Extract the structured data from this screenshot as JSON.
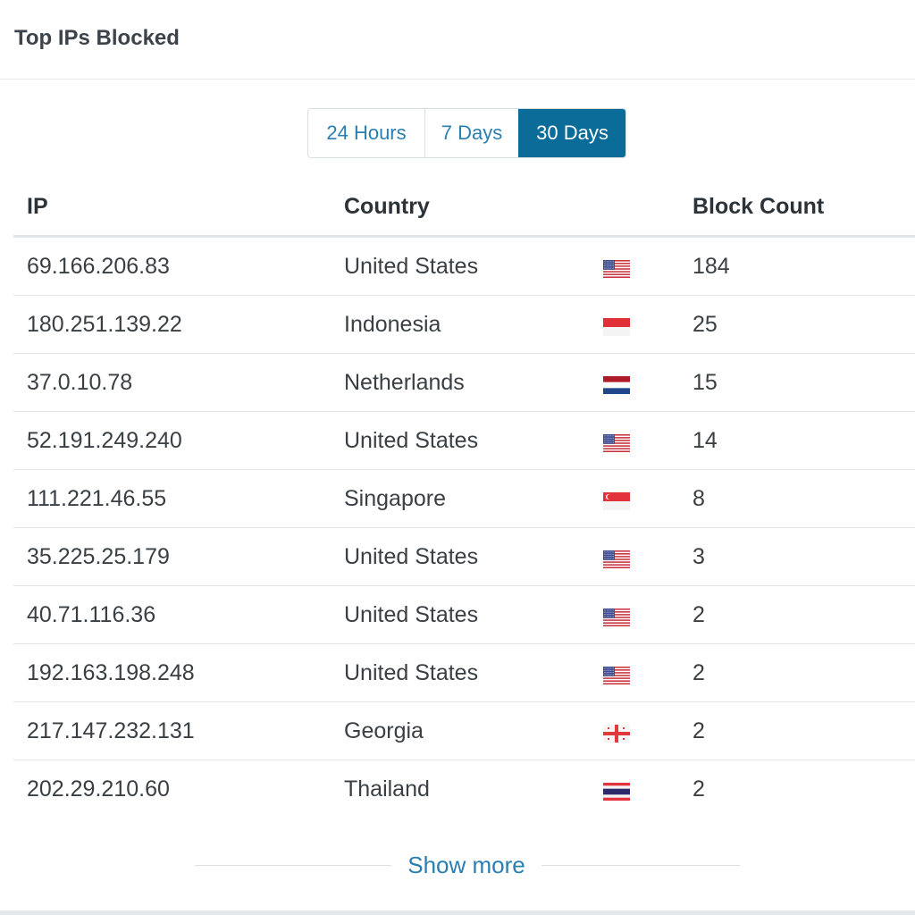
{
  "panel": {
    "title": "Top IPs Blocked"
  },
  "range_options": [
    {
      "label": "24 Hours",
      "active": false
    },
    {
      "label": "7 Days",
      "active": false
    },
    {
      "label": "30 Days",
      "active": true
    }
  ],
  "table": {
    "headers": {
      "ip": "IP",
      "country": "Country",
      "count": "Block Count"
    },
    "rows": [
      {
        "ip": "69.166.206.83",
        "country": "United States",
        "flag": "us-flag-icon",
        "count": "184"
      },
      {
        "ip": "180.251.139.22",
        "country": "Indonesia",
        "flag": "id-flag-icon",
        "count": "25"
      },
      {
        "ip": "37.0.10.78",
        "country": "Netherlands",
        "flag": "nl-flag-icon",
        "count": "15"
      },
      {
        "ip": "52.191.249.240",
        "country": "United States",
        "flag": "us-flag-icon",
        "count": "14"
      },
      {
        "ip": "111.221.46.55",
        "country": "Singapore",
        "flag": "sg-flag-icon",
        "count": "8"
      },
      {
        "ip": "35.225.25.179",
        "country": "United States",
        "flag": "us-flag-icon",
        "count": "3"
      },
      {
        "ip": "40.71.116.36",
        "country": "United States",
        "flag": "us-flag-icon",
        "count": "2"
      },
      {
        "ip": "192.163.198.248",
        "country": "United States",
        "flag": "us-flag-icon",
        "count": "2"
      },
      {
        "ip": "217.147.232.131",
        "country": "Georgia",
        "flag": "ge-flag-icon",
        "count": "2"
      },
      {
        "ip": "202.29.210.60",
        "country": "Thailand",
        "flag": "th-flag-icon",
        "count": "2"
      }
    ]
  },
  "footer": {
    "show_more_label": "Show more"
  },
  "colors": {
    "accent": "#2a7fb0",
    "active_button": "#0b6c9a",
    "title_text": "#3c434a",
    "divider": "#e2e5e8"
  }
}
